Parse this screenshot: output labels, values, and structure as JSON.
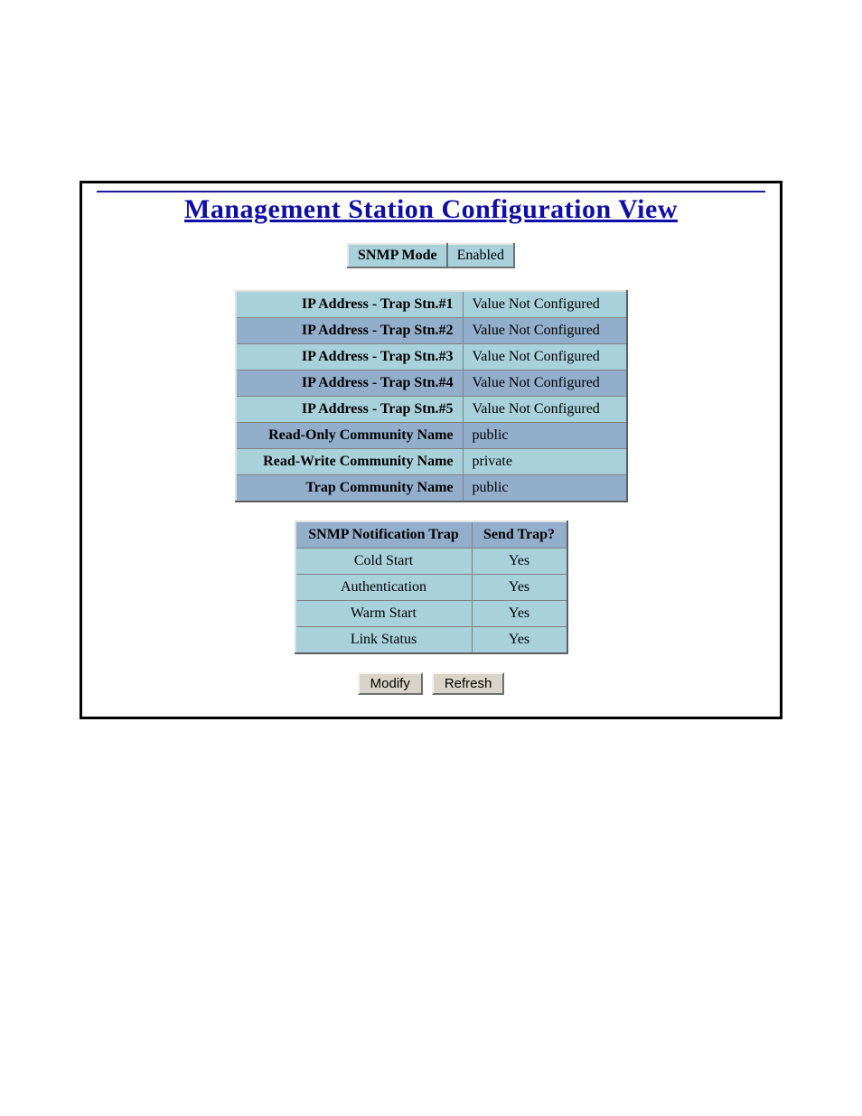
{
  "title": "Management Station Configuration View",
  "snmp_mode": {
    "label": "SNMP Mode",
    "value": "Enabled"
  },
  "config_rows": [
    {
      "label": "IP Address - Trap Stn.#1",
      "value": "Value Not Configured",
      "alt": false
    },
    {
      "label": "IP Address - Trap Stn.#2",
      "value": "Value Not Configured",
      "alt": true
    },
    {
      "label": "IP Address - Trap Stn.#3",
      "value": "Value Not Configured",
      "alt": false
    },
    {
      "label": "IP Address - Trap Stn.#4",
      "value": "Value Not Configured",
      "alt": true
    },
    {
      "label": "IP Address - Trap Stn.#5",
      "value": "Value Not Configured",
      "alt": false
    },
    {
      "label": "Read-Only Community Name",
      "value": "public",
      "alt": true
    },
    {
      "label": "Read-Write Community Name",
      "value": "private",
      "alt": false
    },
    {
      "label": "Trap Community Name",
      "value": "public",
      "alt": true
    }
  ],
  "trap_table": {
    "headers": {
      "name": "SNMP Notification Trap",
      "send": "Send Trap?"
    },
    "rows": [
      {
        "name": "Cold Start",
        "send": "Yes"
      },
      {
        "name": "Authentication",
        "send": "Yes"
      },
      {
        "name": "Warm Start",
        "send": "Yes"
      },
      {
        "name": "Link Status",
        "send": "Yes"
      }
    ]
  },
  "buttons": {
    "modify": "Modify",
    "refresh": "Refresh"
  }
}
